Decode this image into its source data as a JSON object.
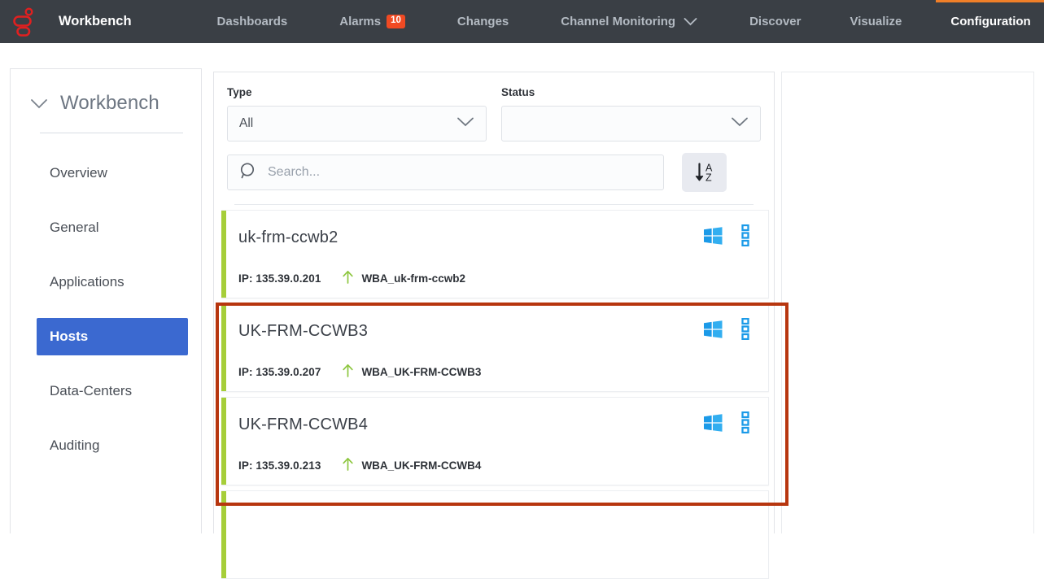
{
  "topnav": {
    "logo": "workbench-logo",
    "brand": "Workbench",
    "items": [
      {
        "label": "Dashboards",
        "active": false,
        "badge": null,
        "chevron": false
      },
      {
        "label": "Alarms",
        "active": false,
        "badge": "10",
        "chevron": false
      },
      {
        "label": "Changes",
        "active": false,
        "badge": null,
        "chevron": false
      },
      {
        "label": "Channel Monitoring",
        "active": false,
        "badge": null,
        "chevron": true
      },
      {
        "label": "Discover",
        "active": false,
        "badge": null,
        "chevron": false
      },
      {
        "label": "Visualize",
        "active": false,
        "badge": null,
        "chevron": false
      },
      {
        "label": "Configuration",
        "active": true,
        "badge": null,
        "chevron": false
      }
    ],
    "bg_color": "#3a3f45",
    "active_underline_color": "#f07f28",
    "badge_color": "#f04a23",
    "logo_color": "#e02020"
  },
  "sidebar": {
    "title": "Workbench",
    "collapse_icon": "chevron-down-icon",
    "items": [
      {
        "label": "Overview",
        "selected": false
      },
      {
        "label": "General",
        "selected": false
      },
      {
        "label": "Applications",
        "selected": false
      },
      {
        "label": "Hosts",
        "selected": true
      },
      {
        "label": "Data-Centers",
        "selected": false
      },
      {
        "label": "Auditing",
        "selected": false
      }
    ],
    "selected_color": "#3b69d0"
  },
  "filters": {
    "type": {
      "label": "Type",
      "value": "All",
      "chevron_icon": "chevron-down-icon"
    },
    "status": {
      "label": "Status",
      "value": "",
      "chevron_icon": "chevron-down-icon"
    },
    "search": {
      "placeholder": "Search...",
      "value": "",
      "icon": "search-icon"
    },
    "sort_button": {
      "label": "A",
      "label2": "Z",
      "icon": "sort-alpha-down-icon"
    }
  },
  "hosts": {
    "accent_color": "#a6ce39",
    "os_icon": "windows-logo-icon",
    "menu_icon": "grid-menu-icon",
    "status_arrow_icon": "arrow-up-icon",
    "ip_prefix": "IP: ",
    "cards": [
      {
        "name": "uk-frm-ccwb2",
        "ip_label": "IP: 135.39.0.201",
        "wba": "WBA_uk-frm-ccwb2",
        "selected": false
      },
      {
        "name": "UK-FRM-CCWB3",
        "ip_label": "IP: 135.39.0.207",
        "wba": "WBA_UK-FRM-CCWB3",
        "selected": true
      },
      {
        "name": "UK-FRM-CCWB4",
        "ip_label": "IP: 135.39.0.213",
        "wba": "WBA_UK-FRM-CCWB4",
        "selected": true
      }
    ],
    "selection_border_color": "#b7360f"
  }
}
